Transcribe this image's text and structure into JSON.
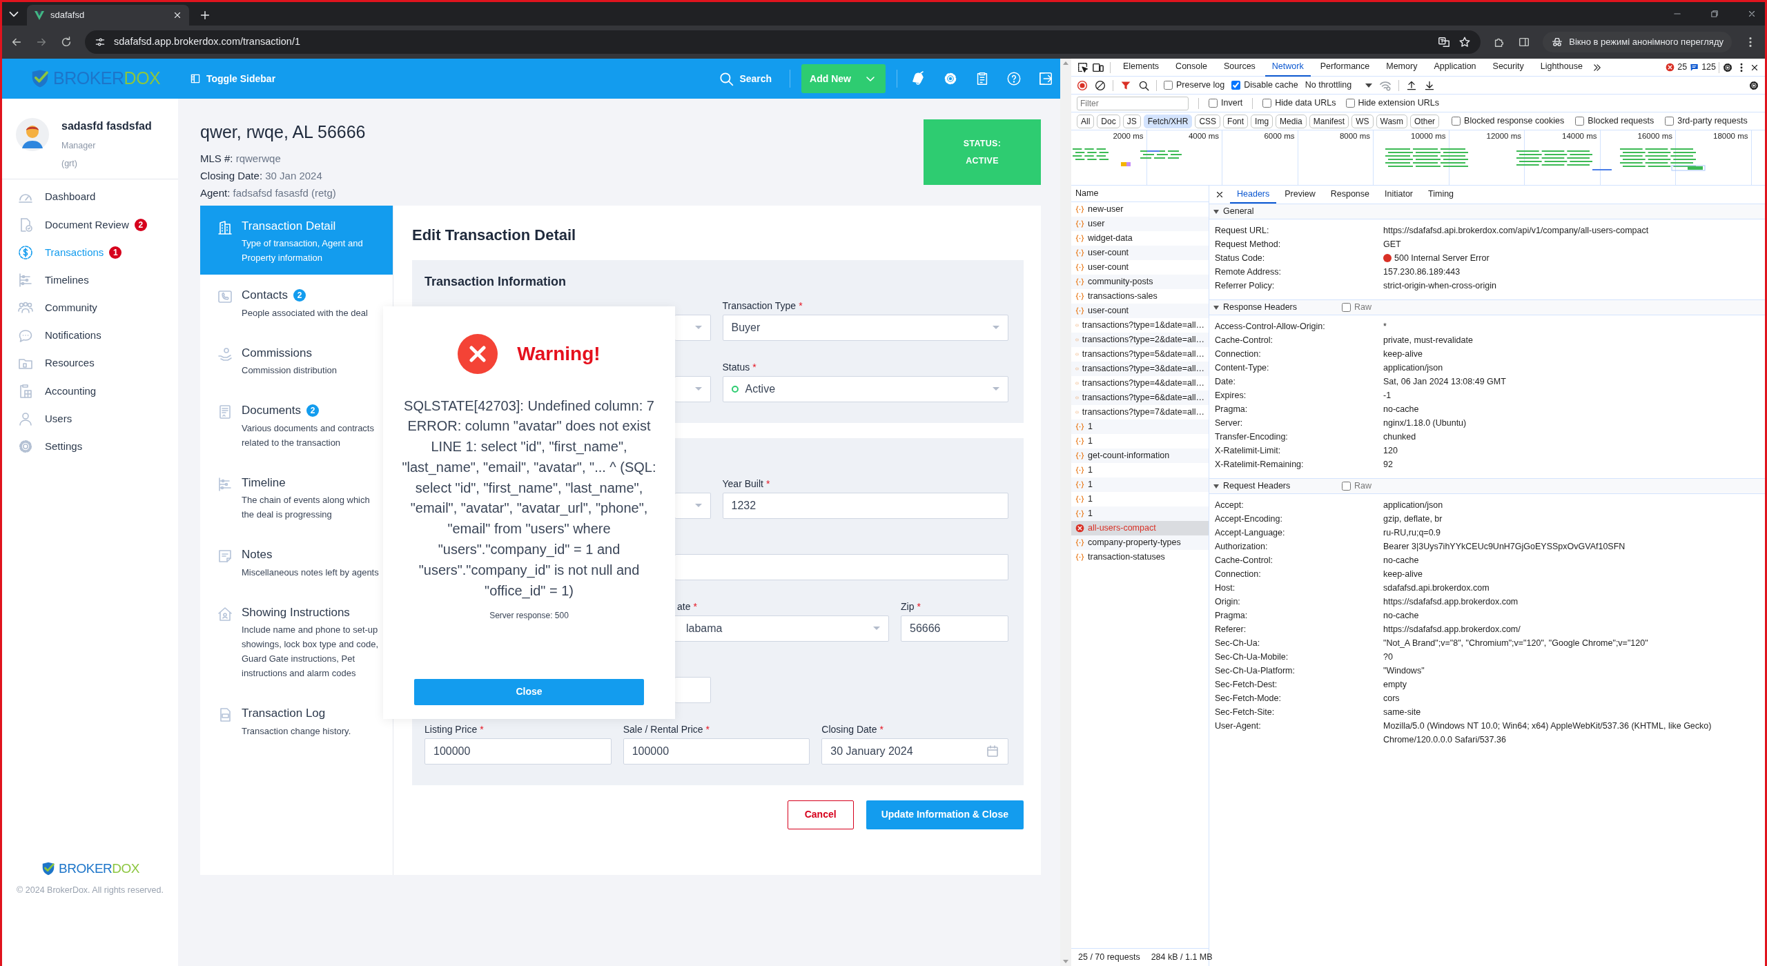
{
  "browser": {
    "tab_title": "sdafafsd",
    "url": "sdafafsd.app.brokerdox.com/transaction/1",
    "incognito_label": "Вікно в режимі анонімного перегляду"
  },
  "app": {
    "logo": [
      "BROKER",
      "DOX"
    ],
    "toggle_sidebar": "Toggle Sidebar",
    "search": "Search",
    "add_new": "Add New",
    "user": {
      "name": "sadasfd fasdsfad",
      "role": "Manager",
      "team": "(grt)"
    },
    "nav": [
      {
        "label": "Dashboard",
        "selected": false
      },
      {
        "label": "Document Review",
        "badge": "2",
        "selected": false
      },
      {
        "label": "Transactions",
        "badge": "1",
        "selected": true
      },
      {
        "label": "Timelines",
        "selected": false
      },
      {
        "label": "Community",
        "selected": false
      },
      {
        "label": "Notifications",
        "selected": false
      },
      {
        "label": "Resources",
        "selected": false
      },
      {
        "label": "Accounting",
        "selected": false
      },
      {
        "label": "Users",
        "selected": false
      },
      {
        "label": "Settings",
        "selected": false
      }
    ],
    "footer_logo": [
      "BROKER",
      "DOX"
    ],
    "copyright": "© 2024 BrokerDox. All rights reserved.",
    "transaction": {
      "title": "qwer, rwqe, AL 56666",
      "facts": [
        {
          "label": "MLS #:",
          "value": "rqwerwqe"
        },
        {
          "label": "Closing Date:",
          "value": "30 Jan 2024"
        },
        {
          "label": "Agent:",
          "value": "fadsafsd fasasfd (retg)"
        }
      ],
      "status": {
        "label": "STATUS:",
        "value": "ACTIVE"
      }
    },
    "sections": [
      {
        "title": "Transaction Detail",
        "description": "Type of transaction, Agent and Property information",
        "selected": true
      },
      {
        "title": "Contacts",
        "badge": "2",
        "description": "People associated with the deal",
        "selected": false
      },
      {
        "title": "Commissions",
        "description": "Commission distribution",
        "selected": false
      },
      {
        "title": "Documents",
        "badge": "2",
        "description": "Various documents and contracts related to the transaction",
        "selected": false
      },
      {
        "title": "Timeline",
        "description": "The chain of events along which the deal is progressing",
        "selected": false
      },
      {
        "title": "Notes",
        "description": "Miscellaneous notes left by agents",
        "selected": false
      },
      {
        "title": "Showing Instructions",
        "description": "Include name and phone to set-up showings, lock box type and code, Guard Gate instructions, Pet instructions and alarm codes",
        "selected": false
      },
      {
        "title": "Transaction Log",
        "description": "Transaction change history.",
        "selected": false
      }
    ],
    "form": {
      "title": "Edit Transaction Detail",
      "groups": [
        {
          "title": "Transaction Information",
          "rows": [
            {
              "kind": "pair",
              "fields": [
                {
                  "kind": "select"
                },
                {
                  "kind": "select",
                  "label": "Transaction Type",
                  "required_mark": "*",
                  "value": "Buyer"
                }
              ]
            },
            {
              "kind": "pair",
              "fields": [
                {
                  "kind": "select"
                },
                {
                  "kind": "select",
                  "label": "Status",
                  "required_mark": "*",
                  "value": "Active",
                  "color": "#2ecc71"
                }
              ]
            }
          ]
        },
        {
          "rows": [
            {
              "kind": "pair",
              "fields": [
                {
                  "kind": "select"
                },
                {
                  "kind": "input",
                  "label": "Year Built",
                  "required_mark": "*",
                  "value": "1232"
                }
              ]
            },
            {
              "kind": "single",
              "fields": [
                {
                  "kind": "input"
                }
              ]
            },
            {
              "kind": "triple",
              "fields": [
                {
                  "kind": "none"
                },
                {
                  "kind": "select",
                  "label": "ate",
                  "required_mark": "*",
                  "value": "labama"
                },
                {
                  "kind": "input",
                  "label": "Zip",
                  "required_mark": "*",
                  "value": "56666"
                }
              ]
            },
            {
              "kind": "pair",
              "fields": [
                {
                  "kind": "input"
                },
                {
                  "kind": "none"
                }
              ]
            },
            {
              "kind": "three",
              "fields": [
                {
                  "kind": "input",
                  "label": "Listing Price",
                  "required_mark": "*",
                  "value": "100000"
                },
                {
                  "kind": "input",
                  "label": "Sale / Rental Price",
                  "required_mark": "*",
                  "value": "100000"
                },
                {
                  "kind": "date",
                  "label": "Closing Date",
                  "required_mark": "*",
                  "value": "30 January 2024"
                }
              ]
            }
          ]
        }
      ],
      "cancel": "Cancel",
      "submit": "Update Information & Close"
    },
    "modal": {
      "title": "Warning!",
      "message": "SQLSTATE[42703]: Undefined column: 7 ERROR: column \"avatar\" does not exist LINE 1: select \"id\", \"first_name\", \"last_name\", \"email\", \"avatar\", \"... ^ (SQL: select \"id\", \"first_name\", \"last_name\", \"email\", \"avatar\", \"avatar_url\", \"phone\", \"email\" from \"users\" where \"users\".\"company_id\" = 1 and \"users\".\"company_id\" is not null and \"office_id\" = 1)",
      "note": "Server response: 500",
      "button": "Close"
    }
  },
  "devtools": {
    "tabs": [
      {
        "label": "Elements",
        "selected": false
      },
      {
        "label": "Console",
        "selected": false
      },
      {
        "label": "Sources",
        "selected": false
      },
      {
        "label": "Network",
        "selected": true
      },
      {
        "label": "Performance",
        "selected": false
      },
      {
        "label": "Memory",
        "selected": false
      },
      {
        "label": "Application",
        "selected": false
      },
      {
        "label": "Security",
        "selected": false
      },
      {
        "label": "Lighthouse",
        "selected": false
      }
    ],
    "errors": "25",
    "messages": "125",
    "toolbar": [
      {
        "label": "Preserve log",
        "checked": false
      },
      {
        "label": "Disable cache",
        "checked": true
      }
    ],
    "throttling": "No throttling",
    "filter": {
      "placeholder": "Filter"
    },
    "filter_options": [
      {
        "label": "Invert",
        "checked": false
      },
      {
        "label": "Hide data URLs",
        "checked": false
      },
      {
        "label": "Hide extension URLs",
        "checked": false
      }
    ],
    "types": [
      {
        "label": "All",
        "selected": false
      },
      {
        "label": "Doc",
        "selected": false
      },
      {
        "label": "JS",
        "selected": false
      },
      {
        "label": "Fetch/XHR",
        "selected": true
      },
      {
        "label": "CSS",
        "selected": false
      },
      {
        "label": "Font",
        "selected": false
      },
      {
        "label": "Img",
        "selected": false
      },
      {
        "label": "Media",
        "selected": false
      },
      {
        "label": "Manifest",
        "selected": false
      },
      {
        "label": "WS",
        "selected": false
      },
      {
        "label": "Wasm",
        "selected": false
      },
      {
        "label": "Other",
        "selected": false
      }
    ],
    "type_options": [
      {
        "label": "Blocked response cookies",
        "checked": false
      },
      {
        "label": "Blocked requests",
        "checked": false
      },
      {
        "label": "3rd-party requests",
        "checked": false
      }
    ],
    "overview_ticks": [
      "2000 ms",
      "4000 ms",
      "6000 ms",
      "8000 ms",
      "10000 ms",
      "12000 ms",
      "14000 ms",
      "16000 ms",
      "18000 ms"
    ],
    "requests": {
      "column": "Name",
      "items": [
        {
          "name": "new-user",
          "kind": "xhr",
          "selected": false
        },
        {
          "name": "user",
          "kind": "xhr",
          "selected": false
        },
        {
          "name": "widget-data",
          "kind": "xhr",
          "selected": false
        },
        {
          "name": "user-count",
          "kind": "xhr",
          "selected": false
        },
        {
          "name": "user-count",
          "kind": "xhr",
          "selected": false
        },
        {
          "name": "community-posts",
          "kind": "xhr",
          "selected": false
        },
        {
          "name": "transactions-sales",
          "kind": "xhr",
          "selected": false
        },
        {
          "name": "user-count",
          "kind": "xhr",
          "selected": false
        },
        {
          "name": "transactions?type=1&date=all…",
          "kind": "xhr",
          "selected": false
        },
        {
          "name": "transactions?type=2&date=all…",
          "kind": "xhr",
          "selected": false
        },
        {
          "name": "transactions?type=5&date=all…",
          "kind": "xhr",
          "selected": false
        },
        {
          "name": "transactions?type=3&date=all…",
          "kind": "xhr",
          "selected": false
        },
        {
          "name": "transactions?type=4&date=all…",
          "kind": "xhr",
          "selected": false
        },
        {
          "name": "transactions?type=6&date=all…",
          "kind": "xhr",
          "selected": false
        },
        {
          "name": "transactions?type=7&date=all…",
          "kind": "xhr",
          "selected": false
        },
        {
          "name": "1",
          "kind": "xhr",
          "selected": false
        },
        {
          "name": "1",
          "kind": "xhr",
          "selected": false
        },
        {
          "name": "get-count-information",
          "kind": "xhr",
          "selected": false
        },
        {
          "name": "1",
          "kind": "xhr",
          "selected": false
        },
        {
          "name": "1",
          "kind": "xhr",
          "selected": false
        },
        {
          "name": "1",
          "kind": "xhr",
          "selected": false
        },
        {
          "name": "1",
          "kind": "xhr",
          "selected": false
        },
        {
          "name": "all-users-compact",
          "kind": "error",
          "selected": true
        },
        {
          "name": "company-property-types",
          "kind": "xhr",
          "selected": false
        },
        {
          "name": "transaction-statuses",
          "kind": "xhr",
          "selected": false
        }
      ]
    },
    "detail_tabs": [
      {
        "label": "Headers",
        "selected": true
      },
      {
        "label": "Preview",
        "selected": false
      },
      {
        "label": "Response",
        "selected": false
      },
      {
        "label": "Initiator",
        "selected": false
      },
      {
        "label": "Timing",
        "selected": false
      }
    ],
    "sections": [
      {
        "title": "General",
        "expanded": true,
        "rows": [
          {
            "key": "Request URL:",
            "value": "https://sdafafsd.api.brokerdox.com/api/v1/company/all-users-compact"
          },
          {
            "key": "Request Method:",
            "value": "GET"
          },
          {
            "key": "Status Code:",
            "value": "500 Internal Server Error",
            "color": "#d93025"
          },
          {
            "key": "Remote Address:",
            "value": "157.230.86.189:443"
          },
          {
            "key": "Referrer Policy:",
            "value": "strict-origin-when-cross-origin"
          }
        ]
      },
      {
        "title": "Response Headers",
        "expanded": true,
        "raw": {
          "label": "Raw",
          "checked": false
        },
        "rows": [
          {
            "key": "Access-Control-Allow-Origin:",
            "value": "*"
          },
          {
            "key": "Cache-Control:",
            "value": "private, must-revalidate"
          },
          {
            "key": "Connection:",
            "value": "keep-alive"
          },
          {
            "key": "Content-Type:",
            "value": "application/json"
          },
          {
            "key": "Date:",
            "value": "Sat, 06 Jan 2024 13:08:49 GMT"
          },
          {
            "key": "Expires:",
            "value": "-1"
          },
          {
            "key": "Pragma:",
            "value": "no-cache"
          },
          {
            "key": "Server:",
            "value": "nginx/1.18.0 (Ubuntu)"
          },
          {
            "key": "Transfer-Encoding:",
            "value": "chunked"
          },
          {
            "key": "X-Ratelimit-Limit:",
            "value": "120"
          },
          {
            "key": "X-Ratelimit-Remaining:",
            "value": "92"
          }
        ]
      },
      {
        "title": "Request Headers",
        "expanded": true,
        "raw": {
          "label": "Raw",
          "checked": false
        },
        "rows": [
          {
            "key": "Accept:",
            "value": "application/json"
          },
          {
            "key": "Accept-Encoding:",
            "value": "gzip, deflate, br"
          },
          {
            "key": "Accept-Language:",
            "value": "ru-RU,ru;q=0.9"
          },
          {
            "key": "Authorization:",
            "value": "Bearer 3|3Uys7ihYYkCEUc9UnH7GjGoEYSSpxOvGVAf10SFN"
          },
          {
            "key": "Cache-Control:",
            "value": "no-cache"
          },
          {
            "key": "Connection:",
            "value": "keep-alive"
          },
          {
            "key": "Host:",
            "value": "sdafafsd.api.brokerdox.com"
          },
          {
            "key": "Origin:",
            "value": "https://sdafafsd.app.brokerdox.com"
          },
          {
            "key": "Pragma:",
            "value": "no-cache"
          },
          {
            "key": "Referer:",
            "value": "https://sdafafsd.app.brokerdox.com/"
          },
          {
            "key": "Sec-Ch-Ua:",
            "value": "\"Not_A Brand\";v=\"8\", \"Chromium\";v=\"120\", \"Google Chrome\";v=\"120\""
          },
          {
            "key": "Sec-Ch-Ua-Mobile:",
            "value": "?0"
          },
          {
            "key": "Sec-Ch-Ua-Platform:",
            "value": "\"Windows\""
          },
          {
            "key": "Sec-Fetch-Dest:",
            "value": "empty"
          },
          {
            "key": "Sec-Fetch-Mode:",
            "value": "cors"
          },
          {
            "key": "Sec-Fetch-Site:",
            "value": "same-site"
          },
          {
            "key": "User-Agent:",
            "value": "Mozilla/5.0 (Windows NT 10.0; Win64; x64) AppleWebKit/537.36 (KHTML, like Gecko) Chrome/120.0.0.0 Safari/537.36"
          }
        ]
      }
    ],
    "status_bar": [
      "25 / 70 requests",
      "284 kB / 1.1 MB"
    ]
  }
}
